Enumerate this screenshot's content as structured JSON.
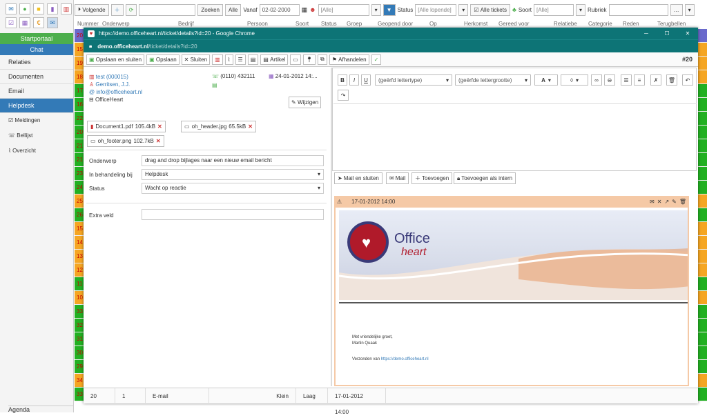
{
  "sidebar": {
    "startportaal": "Startportaal",
    "chat": "Chat",
    "items": [
      "Relaties",
      "Documenten",
      "Email",
      "Helpdesk"
    ],
    "subitems": [
      "Meldingen",
      "Bellijst",
      "Overzicht"
    ],
    "agenda": "Agenda"
  },
  "toolbar": {
    "next": "Volgende",
    "search": "Zoeken",
    "all": "Alle",
    "from": "Vanaf",
    "from_date": "02-02-2000",
    "filter_all": "[Alle]",
    "status_label": "Status",
    "status_value": "[Alle lopende]",
    "all_tickets": "Alle tickets",
    "sort_label": "Soort",
    "sort_value": "[Alle]",
    "category_label": "Rubriek"
  },
  "columns": [
    "Nummer",
    "Onderwerp",
    "Bedrijf",
    "Persoon",
    "Soort",
    "Status",
    "Groep",
    "Geopend door",
    "Op",
    "Herkomst",
    "Gereed voor",
    "Relatiebe",
    "Categorie",
    "Reden",
    "Terugbellen"
  ],
  "row_numbers": [
    "20",
    "15",
    "19",
    "18",
    "17",
    "16",
    "22",
    "20",
    "21",
    "21",
    "23",
    "24",
    "25",
    "26",
    "15",
    "14",
    "13",
    "12",
    "11",
    "10",
    "33",
    "32",
    "31",
    "30",
    "29",
    "34",
    "33",
    "28"
  ],
  "window": {
    "title": "https://demo.officeheart.nl/ticket/details?id=20 - Google Chrome",
    "url_host": "demo.officeheart.nl",
    "url_path": "/ticket/details?id=20"
  },
  "ticket_toolbar": {
    "save_close": "Opslaan en sluiten",
    "save": "Opslaan",
    "close": "Sluiten",
    "article": "Artikel",
    "handle": "Afhandelen",
    "ticket_number": "#20"
  },
  "contact": {
    "name": "test (000015)",
    "person": "Gerritsen, J.J.",
    "email": "info@officeheart.nl",
    "company": "OfficeHeart",
    "phone": "(0110) 432111",
    "date": "24-01-2012 14:...",
    "edit": "Wijzigen"
  },
  "attachments": [
    {
      "name": "Document1.pdf",
      "size": "105.4kB"
    },
    {
      "name": "oh_header.jpg",
      "size": "65.5kB"
    },
    {
      "name": "oh_footer.png",
      "size": "102.7kB"
    }
  ],
  "form": {
    "subject_label": "Onderwerp",
    "subject_value": "drag and drop bijlages naar een nieuw email bericht",
    "handled_by_label": "In behandeling bij",
    "handled_by_value": "Helpdesk",
    "status_label": "Status",
    "status_value": "Wacht op reactie",
    "extra_label": "Extra veld",
    "extra_value": ""
  },
  "editor": {
    "font_placeholder": "(geërfd lettertype)",
    "size_placeholder": "(geërfde lettergrootte)",
    "bold": "B",
    "italic": "I",
    "underline": "U",
    "color_a": "A"
  },
  "mail_buttons": {
    "mail_close": "Mail en sluiten",
    "mail": "Mail",
    "add": "Toevoegen",
    "add_internal": "Toevoegen als intern"
  },
  "message": {
    "date": "17-01-2012 14:00",
    "logo_office": "Office",
    "logo_heart": "heart",
    "greeting": "Met vriendelijke groet,",
    "signature": "Martin Quaak",
    "sent_from": "Verzonden van",
    "sent_link": "https://demo.officeheart.nl"
  },
  "status_bar": {
    "id": "20",
    "count": "1",
    "type": "E-mail",
    "size": "Klein",
    "priority": "Laag",
    "timestamp": "17-01-2012 14:00"
  },
  "colors": {
    "teal": "#0d7476",
    "green_row": "#22b022",
    "orange_row": "#f5a623",
    "blue_active": "#337ab7",
    "message_header": "#f5c9a6"
  }
}
